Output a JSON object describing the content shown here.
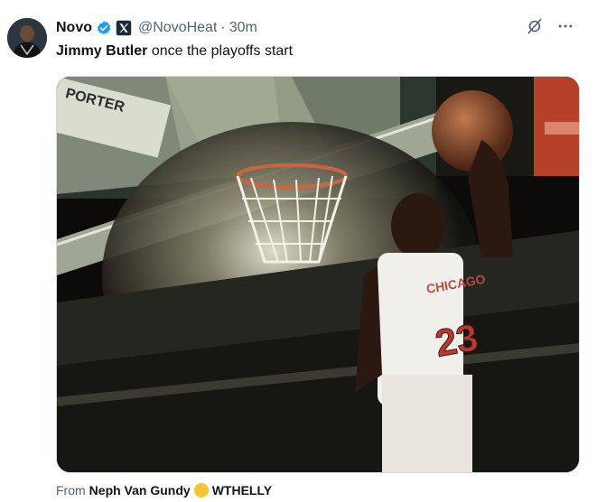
{
  "author": {
    "name": "Novo",
    "handle": "@NovoHeat",
    "separator": "·",
    "time": "30m"
  },
  "tweet": {
    "bold_text": "Jimmy Butler",
    "text": " once the playoffs start"
  },
  "media": {
    "scoreboard_text": "PORTER",
    "jersey_text": "CHICAGO",
    "jersey_number": "23"
  },
  "from": {
    "prefix": "From",
    "source_name": "Neph Van Gundy",
    "source_suffix": "WTHELLY"
  },
  "icons": {
    "verified": "verified-badge-icon",
    "x_logo": "x-logo-icon",
    "grok": "grok-icon",
    "more": "more-icon"
  },
  "colors": {
    "verified_blue": "#1d9bf0",
    "text_primary": "#0f1419",
    "text_secondary": "#536471"
  }
}
